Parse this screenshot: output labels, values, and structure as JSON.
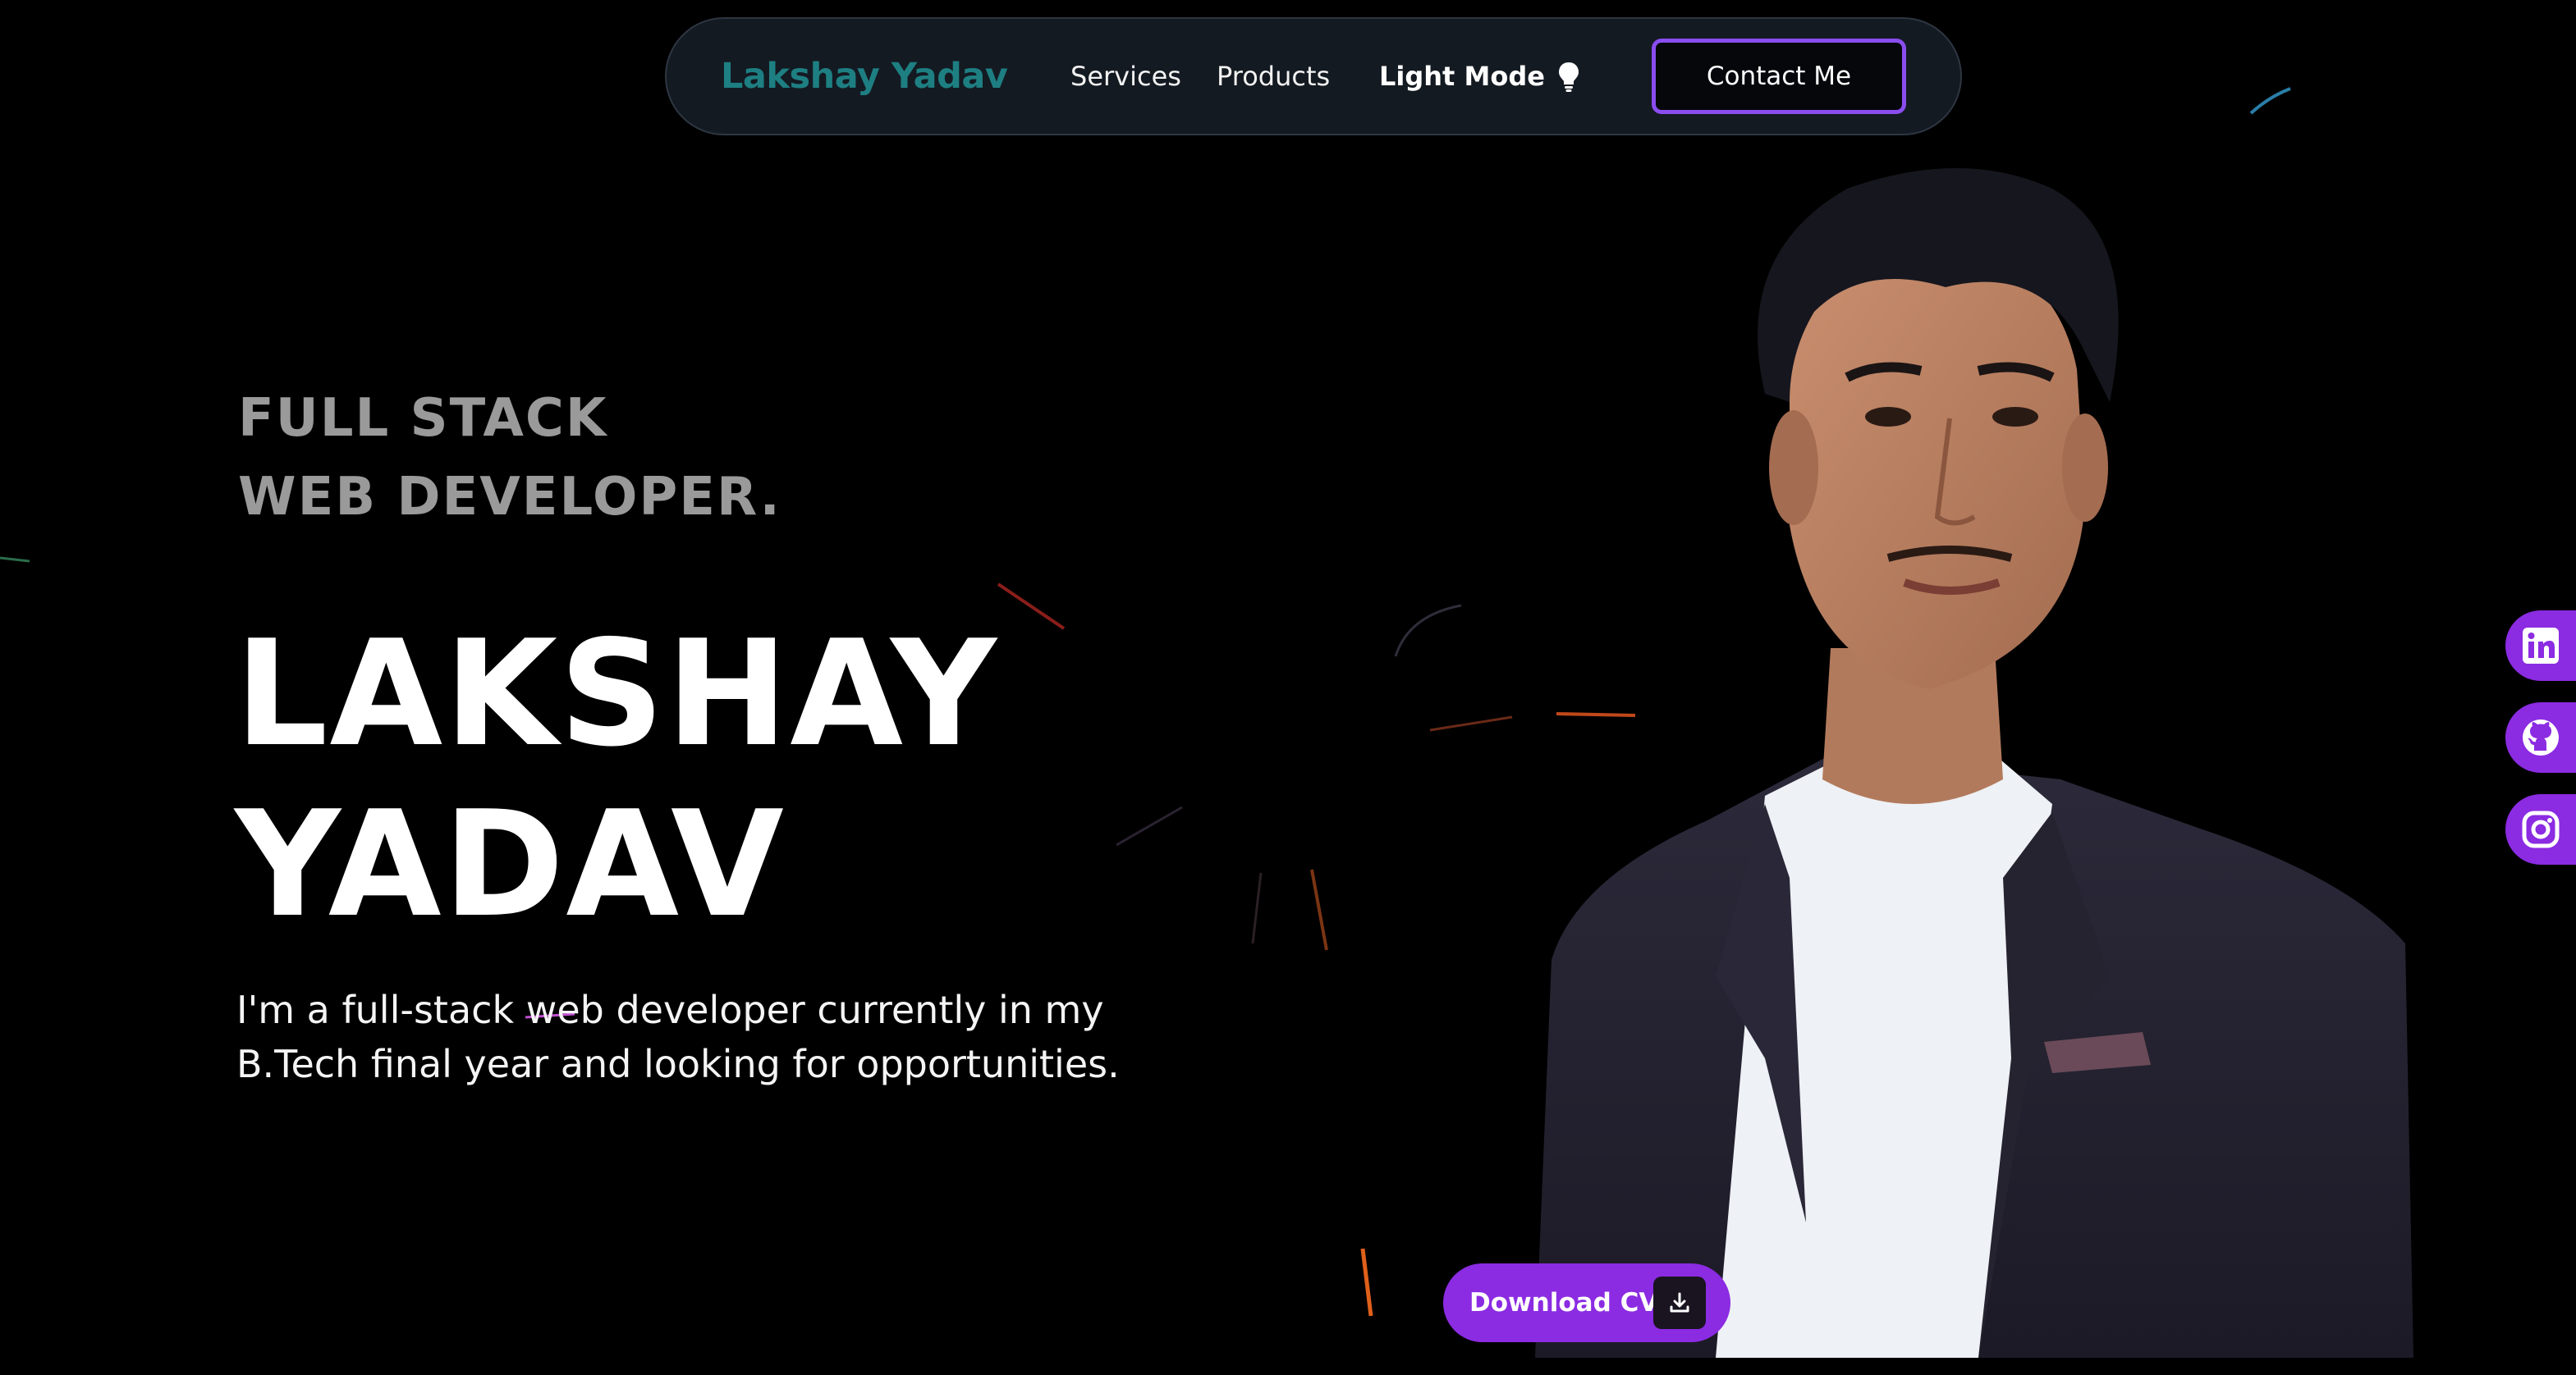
{
  "navbar": {
    "brand": "Lakshay Yadav",
    "links": [
      {
        "label": "Services"
      },
      {
        "label": "Products"
      }
    ],
    "mode_toggle": {
      "label": "Light Mode",
      "icon": "lightbulb-icon"
    },
    "contact_button": "Contact Me"
  },
  "hero": {
    "tagline": [
      "FULL STACK",
      "WEB DEVELOPER."
    ],
    "name": [
      "LAKSHAY",
      "YADAV"
    ],
    "intro": [
      "I'm a full-stack web developer currently in my",
      "B.Tech final year and looking for opportunities."
    ],
    "download_button": {
      "label": "Download CV",
      "icon": "download-icon"
    }
  },
  "social_links": [
    {
      "name": "LinkedIn",
      "icon": "linkedin-icon"
    },
    {
      "name": "GitHub",
      "icon": "github-icon"
    },
    {
      "name": "Instagram",
      "icon": "instagram-icon"
    }
  ],
  "colors": {
    "background": "#000000",
    "accent_purple": "#8b2be2",
    "brand_teal": "#1e7f82",
    "navbar_bg": "#141a22",
    "contact_border": "#8a4df0"
  }
}
